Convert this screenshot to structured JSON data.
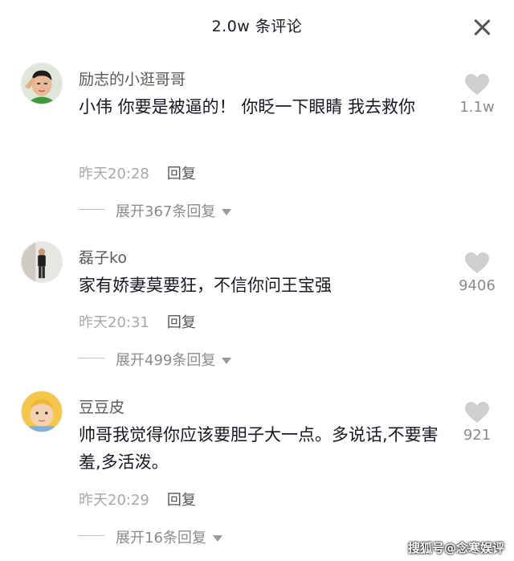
{
  "header": {
    "title": "2.0w 条评论",
    "close_icon": "close-icon"
  },
  "comments": [
    {
      "username": "励志的小逛哥哥",
      "content": "小伟 你要是被逼的！ 你眨一下眼睛 我去救你",
      "time": "昨天20:28",
      "reply_label": "回复",
      "expand_label": "展开367条回复",
      "like_count": "1.1w",
      "avatar_icon": "boy-saluting-avatar"
    },
    {
      "username": "磊子ko",
      "content": "家有娇妻莫要狂，不信你问王宝强",
      "time": "昨天20:31",
      "reply_label": "回复",
      "expand_label": "展开499条回复",
      "like_count": "9406",
      "avatar_icon": "standing-person-avatar"
    },
    {
      "username": "豆豆皮",
      "content": "帅哥我觉得你应该要胆子大一点。多说话,不要害羞,多活泼。",
      "time": "昨天20:29",
      "reply_label": "回复",
      "expand_label": "展开16条回复",
      "like_count": "921",
      "avatar_icon": "baby-avatar"
    }
  ],
  "watermark": "搜狐号@念寒娱评",
  "colors": {
    "text_primary": "#161823",
    "text_secondary": "#a8a8a8",
    "heart": "#cfcfcf"
  }
}
